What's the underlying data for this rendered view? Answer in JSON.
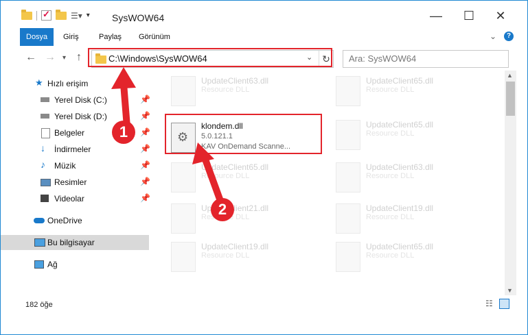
{
  "window": {
    "title": "SysWOW64"
  },
  "ribbon": {
    "tabs": [
      "Dosya",
      "Giriş",
      "Paylaş",
      "Görünüm"
    ]
  },
  "address": {
    "path": "C:\\Windows\\SysWOW64"
  },
  "search": {
    "placeholder": "Ara: SysWOW64"
  },
  "sidebar": {
    "items": [
      {
        "label": "Hızlı erişim",
        "icon": "star-icon"
      },
      {
        "label": "Yerel Disk (C:)",
        "icon": "drive-icon",
        "pinned": true
      },
      {
        "label": "Yerel Disk (D:)",
        "icon": "drive-icon",
        "pinned": true
      },
      {
        "label": "Belgeler",
        "icon": "documents-icon",
        "pinned": true
      },
      {
        "label": "İndirmeler",
        "icon": "downloads-icon",
        "pinned": true
      },
      {
        "label": "Müzik",
        "icon": "music-icon",
        "pinned": true
      },
      {
        "label": "Resimler",
        "icon": "pictures-icon",
        "pinned": true
      },
      {
        "label": "Videolar",
        "icon": "videos-icon",
        "pinned": true
      },
      {
        "label": "OneDrive",
        "icon": "cloud-icon"
      },
      {
        "label": "Bu bilgisayar",
        "icon": "computer-icon",
        "selected": true
      },
      {
        "label": "Ağ",
        "icon": "network-icon"
      }
    ]
  },
  "files": {
    "main": {
      "name": "klondem.dll",
      "version": "5.0.121.1",
      "description": "KAV OnDemand Scanne..."
    },
    "ghosts": [
      {
        "name": "UpdateClient63.dll",
        "desc": "Resource DLL"
      },
      {
        "name": "UpdateClient65.dll",
        "desc": "Resource DLL"
      },
      {
        "name": "UpdateClient65.dll",
        "desc": "Resource DLL"
      },
      {
        "name": "UpdateClient65.dll",
        "desc": "Resource DLL"
      },
      {
        "name": "UpdateClient63.dll",
        "desc": "Resource DLL"
      },
      {
        "name": "UpdateClient21.dll",
        "desc": "Resource DLL"
      },
      {
        "name": "UpdateClient19.dll",
        "desc": "Resource DLL"
      },
      {
        "name": "UpdateClient19.dll",
        "desc": "Resource DLL"
      },
      {
        "name": "UpdateClient65.dll",
        "desc": "Resource DLL"
      }
    ]
  },
  "status": {
    "count": "182 öğe"
  },
  "annotations": {
    "step1": "1",
    "step2": "2"
  },
  "colors": {
    "accent": "#1979ca",
    "highlight": "#e3242b"
  }
}
